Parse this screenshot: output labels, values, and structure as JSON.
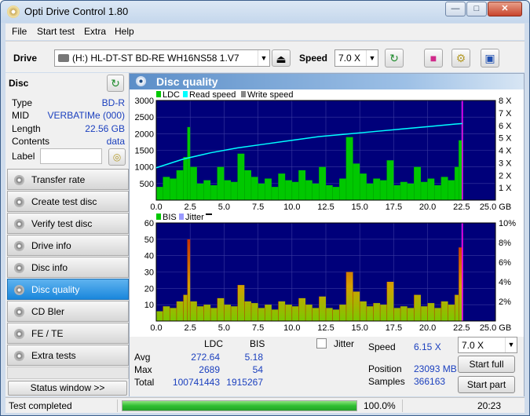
{
  "window": {
    "title": "Opti Drive Control 1.80"
  },
  "menu": [
    "File",
    "Start test",
    "Extra",
    "Help"
  ],
  "toolbar": {
    "drive_label": "Drive",
    "drive_value": "(H:)  HL-DT-ST BD-RE  WH16NS58 1.V7",
    "speed_label": "Speed",
    "speed_value": "7.0 X"
  },
  "disc": {
    "title": "Disc",
    "rows": [
      {
        "key": "Type",
        "value": "BD-R"
      },
      {
        "key": "MID",
        "value": "VERBATIMe (000)"
      },
      {
        "key": "Length",
        "value": "22.56 GB"
      },
      {
        "key": "Contents",
        "value": "data"
      }
    ],
    "label_key": "Label",
    "label_value": ""
  },
  "nav": [
    {
      "label": "Transfer rate",
      "active": false
    },
    {
      "label": "Create test disc",
      "active": false
    },
    {
      "label": "Verify test disc",
      "active": false
    },
    {
      "label": "Drive info",
      "active": false
    },
    {
      "label": "Disc info",
      "active": false
    },
    {
      "label": "Disc quality",
      "active": true
    },
    {
      "label": "CD Bler",
      "active": false
    },
    {
      "label": "FE / TE",
      "active": false
    },
    {
      "label": "Extra tests",
      "active": false
    }
  ],
  "status_window_label": "Status window >>",
  "panel_title": "Disc quality",
  "colors": {
    "ldc": "#00c800",
    "read_speed": "#00ffff",
    "write_speed": "#888888",
    "bis": "#00c800",
    "jitter": "#9a9aff",
    "plot_bg": "#00007a",
    "highlight": "#ff00ff"
  },
  "chart_data": [
    {
      "type": "area",
      "legend": [
        "LDC",
        "Read speed",
        "Write speed"
      ],
      "x": [
        0,
        0.5,
        1.0,
        1.5,
        2.0,
        2.3,
        2.5,
        3.0,
        3.5,
        4.0,
        4.5,
        5.0,
        5.5,
        6.0,
        6.5,
        7.0,
        7.5,
        8.0,
        8.5,
        9.0,
        9.5,
        10.0,
        10.5,
        11.0,
        11.5,
        12.0,
        12.5,
        13.0,
        13.5,
        14.0,
        14.5,
        15.0,
        15.5,
        16.0,
        16.5,
        17.0,
        17.5,
        18.0,
        18.5,
        19.0,
        19.5,
        20.0,
        20.5,
        21.0,
        21.5,
        22.0,
        22.3,
        22.56
      ],
      "ldc": [
        400,
        700,
        650,
        900,
        1300,
        2200,
        1000,
        500,
        600,
        450,
        1000,
        600,
        550,
        1400,
        900,
        700,
        500,
        650,
        400,
        800,
        600,
        550,
        900,
        600,
        500,
        1000,
        450,
        400,
        650,
        1900,
        1100,
        800,
        500,
        650,
        600,
        1200,
        450,
        550,
        500,
        1000,
        550,
        650,
        450,
        700,
        600,
        1000,
        1800,
        2400
      ],
      "read_speed_x": [
        0,
        2,
        4,
        6,
        8,
        10,
        12,
        14,
        16,
        18,
        20,
        22,
        22.56
      ],
      "read_speed": [
        2.6,
        3.3,
        3.8,
        4.2,
        4.5,
        4.8,
        5.1,
        5.3,
        5.5,
        5.7,
        5.9,
        6.1,
        6.15
      ],
      "xlim": [
        0,
        25
      ],
      "ylim": [
        0,
        3000
      ],
      "y2lim": [
        0,
        8
      ],
      "xticks": [
        "0.0",
        "2.5",
        "5.0",
        "7.5",
        "10.0",
        "12.5",
        "15.0",
        "17.5",
        "20.0",
        "22.5",
        "25.0 GB"
      ],
      "yticks": [
        "500",
        "1000",
        "1500",
        "2000",
        "2500",
        "3000"
      ],
      "y2ticks": [
        "1 X",
        "2 X",
        "3 X",
        "4 X",
        "5 X",
        "6 X",
        "7 X",
        "8 X"
      ]
    },
    {
      "type": "area",
      "legend": [
        "BIS",
        "Jitter"
      ],
      "x": [
        0,
        0.5,
        1.0,
        1.5,
        2.0,
        2.3,
        2.5,
        3.0,
        3.5,
        4.0,
        4.5,
        5.0,
        5.5,
        6.0,
        6.5,
        7.0,
        7.5,
        8.0,
        8.5,
        9.0,
        9.5,
        10.0,
        10.5,
        11.0,
        11.5,
        12.0,
        12.5,
        13.0,
        13.5,
        14.0,
        14.5,
        15.0,
        15.5,
        16.0,
        16.5,
        17.0,
        17.5,
        18.0,
        18.5,
        19.0,
        19.5,
        20.0,
        20.5,
        21.0,
        21.5,
        22.0,
        22.3,
        22.56
      ],
      "bis": [
        6,
        9,
        8,
        12,
        16,
        50,
        12,
        9,
        10,
        8,
        14,
        10,
        9,
        22,
        12,
        11,
        8,
        10,
        7,
        12,
        10,
        9,
        14,
        10,
        8,
        15,
        8,
        7,
        10,
        30,
        18,
        12,
        9,
        11,
        10,
        24,
        8,
        9,
        8,
        16,
        9,
        11,
        8,
        12,
        10,
        16,
        45,
        54
      ],
      "xlim": [
        0,
        25
      ],
      "ylim": [
        0,
        60
      ],
      "y2lim": [
        0,
        10
      ],
      "xticks": [
        "0.0",
        "2.5",
        "5.0",
        "7.5",
        "10.0",
        "12.5",
        "15.0",
        "17.5",
        "20.0",
        "22.5",
        "25.0 GB"
      ],
      "yticks": [
        "10",
        "20",
        "30",
        "40",
        "50",
        "60"
      ],
      "y2ticks": [
        "2%",
        "4%",
        "6%",
        "8%",
        "10%"
      ]
    }
  ],
  "stats": {
    "col_ldc": "LDC",
    "col_bis": "BIS",
    "rows": [
      {
        "label": "Avg",
        "ldc": "272.64",
        "bis": "5.18"
      },
      {
        "label": "Max",
        "ldc": "2689",
        "bis": "54"
      },
      {
        "label": "Total",
        "ldc": "100741443",
        "bis": "1915267"
      }
    ],
    "jitter_label": "Jitter",
    "speed_label": "Speed",
    "speed_value": "6.15 X",
    "position_label": "Position",
    "position_value": "23093 MB",
    "samples_label": "Samples",
    "samples_value": "366163",
    "speed_select": "7.0 X",
    "start_full": "Start full",
    "start_part": "Start part"
  },
  "statusbar": {
    "text": "Test completed",
    "progress": 100,
    "progress_text": "100.0%",
    "time": "20:23"
  }
}
